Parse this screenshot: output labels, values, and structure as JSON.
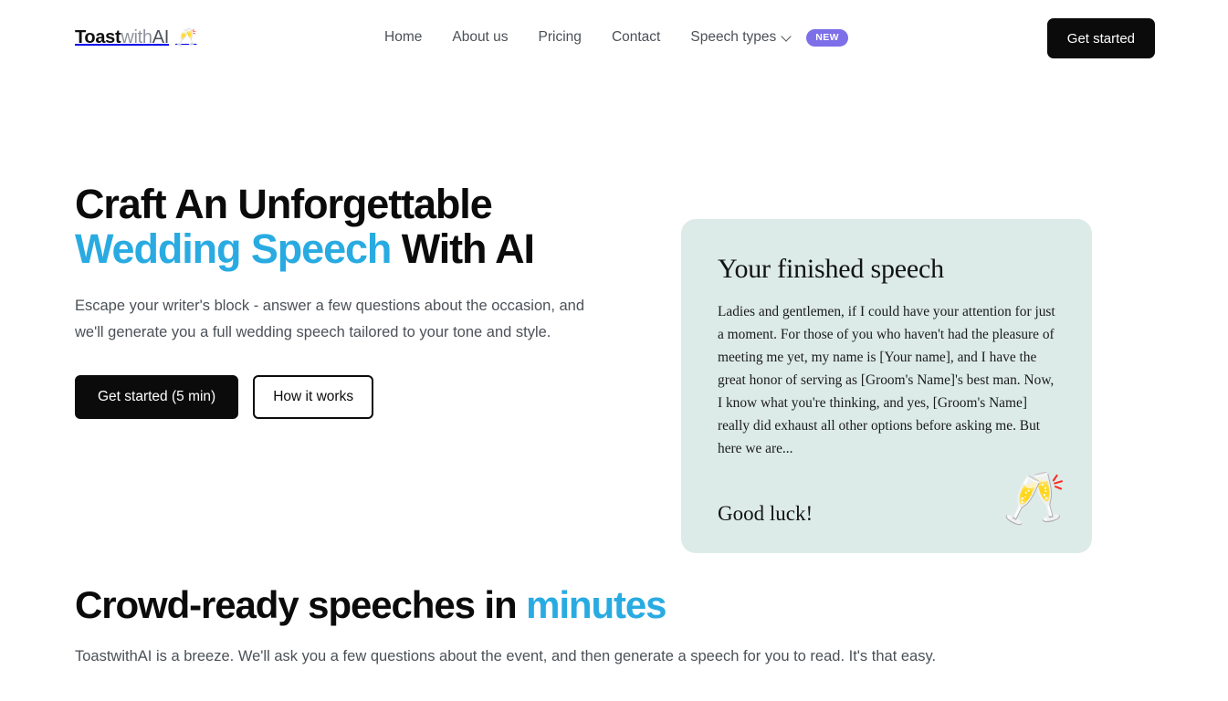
{
  "header": {
    "logo": {
      "part1": "Toast",
      "part2": "with",
      "part3": "AI",
      "emoji": "🥂"
    },
    "nav": [
      {
        "label": "Home"
      },
      {
        "label": "About us"
      },
      {
        "label": "Pricing"
      },
      {
        "label": "Contact"
      }
    ],
    "dropdown": {
      "label": "Speech types",
      "badge": "NEW"
    },
    "cta_label": "Get started"
  },
  "hero": {
    "title_line1": "Craft An Unforgettable",
    "title_accent": "Wedding Speech",
    "title_tail": " With AI",
    "subtitle": "Escape your writer's block - answer a few questions about the occasion, and we'll generate you a full wedding speech tailored to your tone and style.",
    "primary_button": "Get started (5 min)",
    "secondary_button": "How it works"
  },
  "speech_card": {
    "title": "Your finished speech",
    "body": "Ladies and gentlemen, if I could have your attention for just a moment. For those of you who haven't had the pleasure of meeting me yet, my name is [Your name], and I have the great honor of serving as [Groom's Name]'s best man. Now, I know what you're thinking, and yes, [Groom's Name] really did exhaust all other options before asking me. But here we are...",
    "closing": "Good luck!",
    "emoji": "🥂"
  },
  "section_two": {
    "title_main": "Crowd-ready speeches in ",
    "title_accent": "minutes",
    "subtitle": "ToastwithAI is a breeze. We'll ask you a few questions about the event, and then generate a speech for you to read. It's that easy."
  },
  "colors": {
    "accent": "#29abe2",
    "badge": "#7c6fe8",
    "card_bg": "#dcebe8",
    "dark": "#0b0b0b"
  }
}
